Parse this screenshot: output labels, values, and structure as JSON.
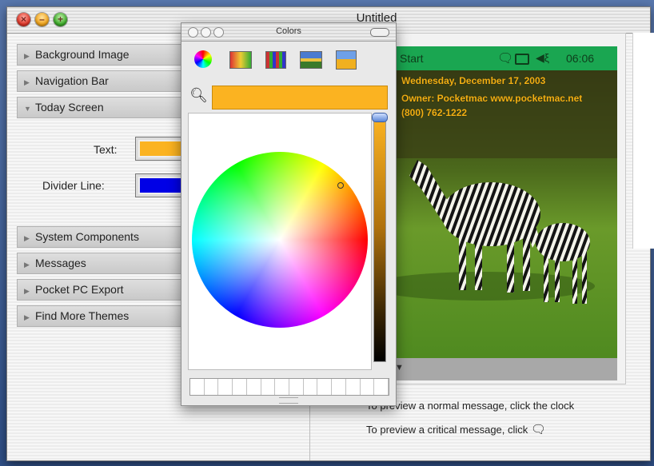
{
  "window": {
    "title": "Untitled"
  },
  "left_panel": {
    "sections_top": [
      {
        "label": "Background Image",
        "expanded": false
      },
      {
        "label": "Navigation Bar",
        "expanded": false
      },
      {
        "label": "Today Screen",
        "expanded": true
      }
    ],
    "today_screen": {
      "text_label": "Text:",
      "text_color": "#fbb321",
      "divider_label": "Divider Line:",
      "divider_color": "#0000e6"
    },
    "sections_bottom": [
      {
        "label": "System Components",
        "expanded": false
      },
      {
        "label": "Messages",
        "expanded": false
      },
      {
        "label": "Pocket PC Export",
        "expanded": false
      },
      {
        "label": "Find More Themes",
        "expanded": false
      }
    ]
  },
  "colors_panel": {
    "title": "Colors",
    "tools": [
      "color-wheel-icon",
      "color-sliders-icon",
      "color-palettes-icon",
      "image-palettes-icon",
      "crayons-icon"
    ],
    "current_color": "#fbb321"
  },
  "preview": {
    "nav_start": "Start",
    "nav_time": "06:06",
    "today_lines": [
      "Wednesday, December 17, 2003",
      "Owner: Pocketmac www.pocketmac.net",
      "(800) 762-1222"
    ],
    "msg_normal": "To preview a normal message, click the clock",
    "msg_critical": "To preview a critical message, click"
  }
}
